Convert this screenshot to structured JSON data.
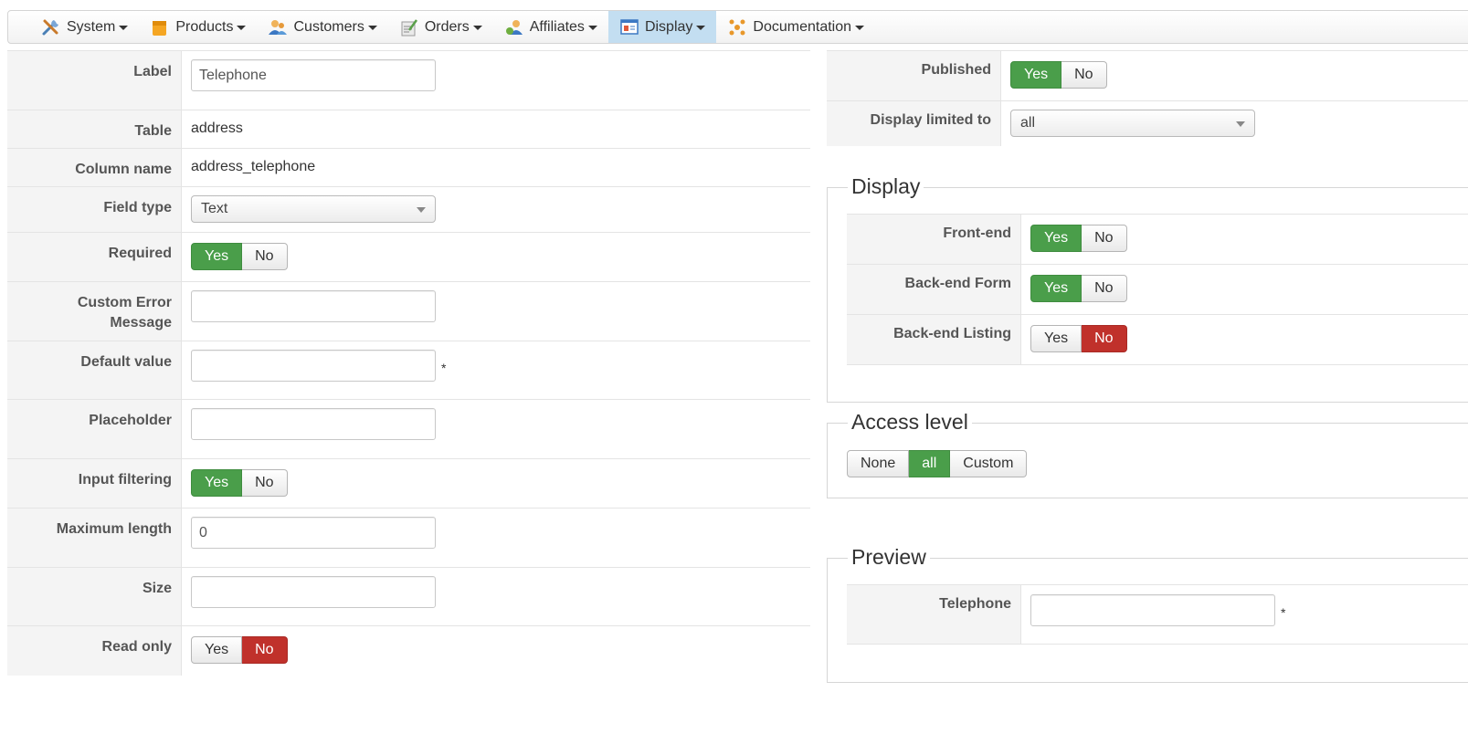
{
  "menu": [
    {
      "label": "System",
      "icon": "tools-icon"
    },
    {
      "label": "Products",
      "icon": "products-icon"
    },
    {
      "label": "Customers",
      "icon": "customers-icon"
    },
    {
      "label": "Orders",
      "icon": "orders-icon"
    },
    {
      "label": "Affiliates",
      "icon": "affiliates-icon"
    },
    {
      "label": "Display",
      "icon": "display-icon",
      "active": true
    },
    {
      "label": "Documentation",
      "icon": "documentation-icon"
    }
  ],
  "form": {
    "label": {
      "title": "Label",
      "value": "Telephone"
    },
    "table": {
      "title": "Table",
      "value": "address"
    },
    "column_name": {
      "title": "Column name",
      "value": "address_telephone"
    },
    "field_type": {
      "title": "Field type",
      "value": "Text"
    },
    "required": {
      "title": "Required",
      "yes": "Yes",
      "no": "No",
      "selected": "Yes"
    },
    "custom_error": {
      "title": "Custom Error Message",
      "value": ""
    },
    "default_value": {
      "title": "Default value",
      "value": "",
      "asterisk": "*"
    },
    "placeholder": {
      "title": "Placeholder",
      "value": ""
    },
    "input_filtering": {
      "title": "Input filtering",
      "yes": "Yes",
      "no": "No",
      "selected": "Yes"
    },
    "max_length": {
      "title": "Maximum length",
      "value": "0"
    },
    "size": {
      "title": "Size",
      "value": ""
    },
    "read_only": {
      "title": "Read only",
      "yes": "Yes",
      "no": "No",
      "selected": "No"
    }
  },
  "right": {
    "published": {
      "title": "Published",
      "yes": "Yes",
      "no": "No",
      "selected": "Yes"
    },
    "display_limited": {
      "title": "Display limited to",
      "value": "all"
    }
  },
  "display_section": {
    "legend": "Display",
    "front_end": {
      "title": "Front-end",
      "yes": "Yes",
      "no": "No",
      "selected": "Yes"
    },
    "back_end_form": {
      "title": "Back-end Form",
      "yes": "Yes",
      "no": "No",
      "selected": "Yes"
    },
    "back_end_listing": {
      "title": "Back-end Listing",
      "yes": "Yes",
      "no": "No",
      "selected": "No"
    }
  },
  "access_section": {
    "legend": "Access level",
    "none": "None",
    "all": "all",
    "custom": "Custom",
    "selected": "all"
  },
  "preview_section": {
    "legend": "Preview",
    "telephone": {
      "title": "Telephone",
      "value": "",
      "asterisk": "*"
    }
  },
  "colors": {
    "green": "#4a9e4a",
    "red": "#c0312b",
    "active_menu": "#c3def1"
  }
}
